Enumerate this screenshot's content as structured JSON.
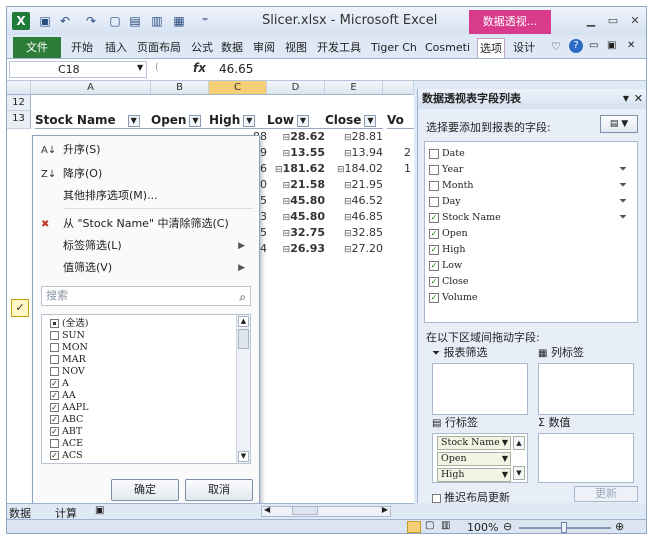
{
  "window": {
    "title": "Slicer.xlsx - Microsoft Excel",
    "contextual_tab": "数据透视...",
    "app_letter": "X"
  },
  "ribbon_tabs": [
    "文件",
    "开始",
    "插入",
    "页面布局",
    "公式",
    "数据",
    "审阅",
    "视图",
    "开发工具",
    "Tiger Ch",
    "Cosmeti",
    "选项",
    "设计"
  ],
  "formula_bar": {
    "cell_ref": "C18",
    "fx": "fx",
    "value": "46.65"
  },
  "sheet": {
    "col_headers": [
      "A",
      "B",
      "C",
      "D",
      "E"
    ],
    "rows": [
      "12",
      "13"
    ],
    "header_cells": [
      "Stock Name",
      "Open",
      "High",
      "Low",
      "Close",
      "Vo"
    ],
    "high_col": [
      "88",
      "99",
      "16",
      "10",
      "65",
      "13",
      "65",
      "34"
    ],
    "low_col": [
      "28.62",
      "13.55",
      "181.62",
      "21.58",
      "45.80",
      "45.80",
      "32.75",
      "26.93"
    ],
    "close_col": [
      "28.81",
      "13.94",
      "184.02",
      "21.95",
      "46.52",
      "46.85",
      "32.85",
      "27.20"
    ],
    "vol_col": [
      "",
      "2",
      "1",
      "",
      "",
      "",
      "",
      ""
    ]
  },
  "filter_menu": {
    "items": [
      {
        "icon": "A↓",
        "label": "升序(S)"
      },
      {
        "icon": "Z↓",
        "label": "降序(O)"
      },
      {
        "icon": "",
        "label": "其他排序选项(M)..."
      },
      {
        "icon": "✖",
        "label": "从 \"Stock Name\" 中清除筛选(C)"
      },
      {
        "icon": "",
        "label": "标签筛选(L)",
        "submenu": true
      },
      {
        "icon": "",
        "label": "值筛选(V)",
        "submenu": true
      }
    ],
    "search_placeholder": "搜索",
    "list": [
      {
        "label": "(全选)",
        "state": "partial"
      },
      {
        "label": "SUN",
        "state": "off"
      },
      {
        "label": "MON",
        "state": "off"
      },
      {
        "label": "MAR",
        "state": "off"
      },
      {
        "label": "NOV",
        "state": "off"
      },
      {
        "label": "A",
        "state": "on"
      },
      {
        "label": "AA",
        "state": "on"
      },
      {
        "label": "AAPL",
        "state": "on"
      },
      {
        "label": "ABC",
        "state": "on"
      },
      {
        "label": "ABT",
        "state": "on"
      },
      {
        "label": "ACE",
        "state": "off"
      },
      {
        "label": "ACS",
        "state": "on"
      }
    ],
    "ok": "确定",
    "cancel": "取消"
  },
  "pane": {
    "title": "数据透视表字段列表",
    "choose_label": "选择要添加到报表的字段:",
    "fields": [
      {
        "name": "Date",
        "checked": false,
        "filtered": false
      },
      {
        "name": "Year",
        "checked": false,
        "filtered": true
      },
      {
        "name": "Month",
        "checked": false,
        "filtered": true
      },
      {
        "name": "Day",
        "checked": false,
        "filtered": true
      },
      {
        "name": "Stock Name",
        "checked": true,
        "filtered": true
      },
      {
        "name": "Open",
        "checked": true,
        "filtered": false
      },
      {
        "name": "High",
        "checked": true,
        "filtered": false
      },
      {
        "name": "Low",
        "checked": true,
        "filtered": false
      },
      {
        "name": "Close",
        "checked": true,
        "filtered": false
      },
      {
        "name": "Volume",
        "checked": true,
        "filtered": false
      }
    ],
    "drag_label": "在以下区域间拖动字段:",
    "report_filter": "报表筛选",
    "column_labels": "列标签",
    "row_labels": "行标签",
    "values": "数值",
    "row_chips": [
      "Stock Name",
      "Open",
      "High"
    ],
    "defer_label": "推迟布局更新",
    "update_btn": "更新"
  },
  "sheet_tabs": [
    "数据",
    "计算"
  ],
  "status": {
    "zoom": "100%"
  }
}
